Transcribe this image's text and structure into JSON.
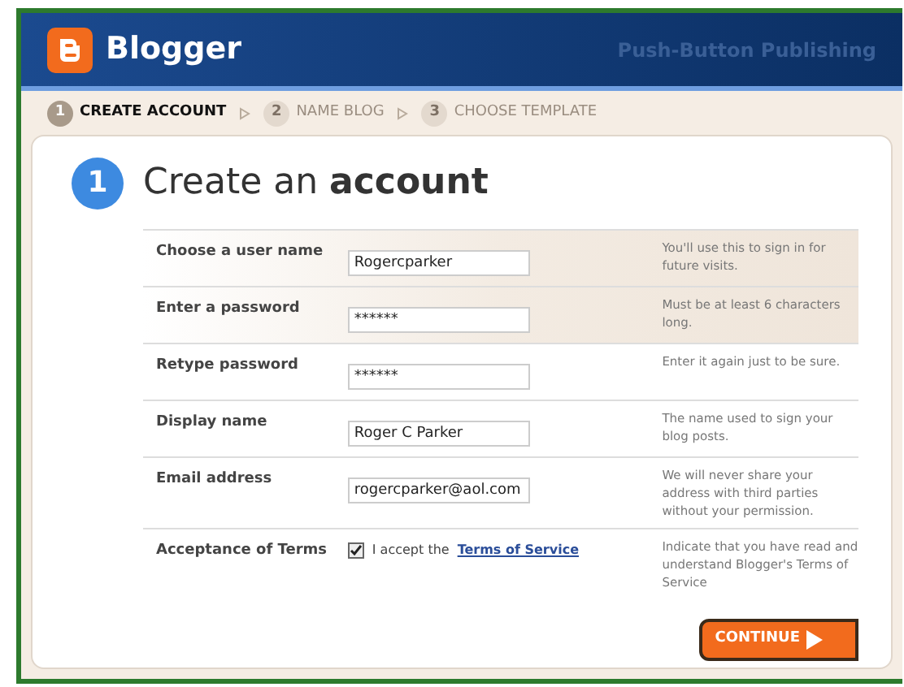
{
  "header": {
    "brand": "Blogger",
    "tagline": "Push-Button Publishing"
  },
  "steps": [
    {
      "number": "1",
      "label": "CREATE ACCOUNT",
      "selected": true
    },
    {
      "number": "2",
      "label": "NAME BLOG",
      "selected": false
    },
    {
      "number": "3",
      "label": "CHOOSE TEMPLATE",
      "selected": false
    }
  ],
  "form": {
    "step_number": "1",
    "title": "Create an **account**",
    "fields": [
      {
        "label": "Choose a user name",
        "value": "Rogercparker",
        "hint": "You'll use this to sign in for future visits.",
        "highlighted": true
      },
      {
        "label": "Enter a password",
        "value": "******",
        "hint": "Must be at least 6 characters long.",
        "highlighted": true
      },
      {
        "label": "Retype password",
        "value": "******",
        "hint": "Enter it again just to be sure.",
        "highlighted": false
      },
      {
        "label": "Display name",
        "value": "Roger C Parker",
        "hint": "The name used to sign your blog posts.",
        "highlighted": false
      },
      {
        "label": "Email address",
        "value": "rogercparker@aol.com",
        "hint": "We will never share your address with third parties without your permission.",
        "highlighted": false
      }
    ],
    "terms": {
      "label": "Acceptance of Terms",
      "checked": true,
      "text": "I accept the",
      "link": "Terms of Service",
      "hint": "Indicate that you have read and understand Blogger's Terms of Service"
    },
    "continue": "CONTINUE"
  }
}
